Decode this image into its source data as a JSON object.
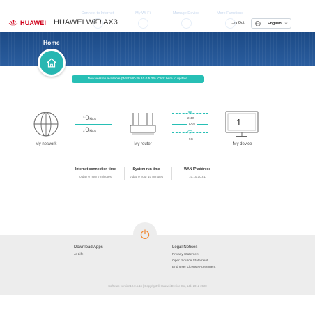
{
  "header": {
    "brand": "HUAWEI",
    "product_title": "HUAWEI WiFi AX3",
    "logout_label": "Log Out",
    "language": "English"
  },
  "nav": {
    "home": "Home",
    "items": [
      {
        "label": "Connect to Internet",
        "icon": "globe-icon"
      },
      {
        "label": "My Wi-Fi",
        "icon": "wifi-icon"
      },
      {
        "label": "Manage Device",
        "icon": "user-icon"
      },
      {
        "label": "More Functions",
        "icon": "menu-icon"
      }
    ]
  },
  "banner": {
    "text": "New version available (WS7100-20 10.0.5.26). Click here to update."
  },
  "topology": {
    "network_label": "My network",
    "router_label": "My router",
    "device_label": "My device",
    "upload_value": "0",
    "upload_unit": "kbps",
    "download_value": "0",
    "download_unit": "kbps",
    "bands": [
      "2.4G",
      "LAN",
      "5G"
    ],
    "device_count": "1"
  },
  "stats": [
    {
      "title": "Internet connection time",
      "value": "0 day 0 hour 7 minutes"
    },
    {
      "title": "System run time",
      "value": "0 day 0 hour 10 minutes"
    },
    {
      "title": "WAN IP address",
      "value": "10.10.10.81"
    }
  ],
  "footer": {
    "download_heading": "Download Apps",
    "app_name": "AI Life",
    "legal_heading": "Legal Notices",
    "legal_links": [
      "Privacy Statement",
      "Open Source Statement",
      "End User License Agreement"
    ],
    "copyright": "Software version10.0.5.16 | Copyright © Huawei Device Co., Ltd. 2012-2020"
  },
  "colors": {
    "brand_red": "#d0021b",
    "accent_teal": "#27bfb5",
    "nav_blue": "#1f4d8c",
    "power_orange": "#f08a36"
  }
}
